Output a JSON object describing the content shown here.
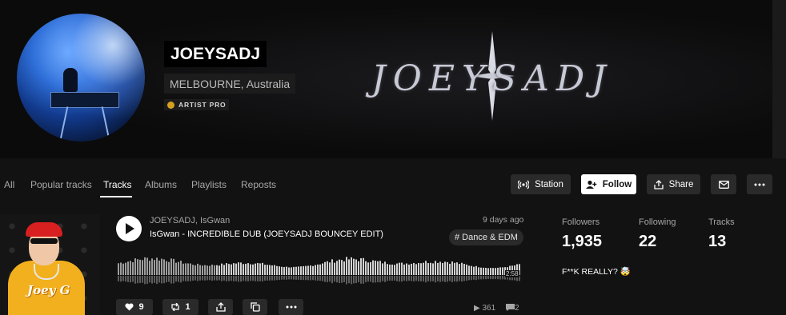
{
  "profile": {
    "name": "JOEYSADJ",
    "location": "MELBOURNE, Australia",
    "badge": "ARTIST PRO",
    "banner_logo_text": "JOEYSADJ"
  },
  "tabs": [
    {
      "label": "All",
      "active": false
    },
    {
      "label": "Popular tracks",
      "active": false
    },
    {
      "label": "Tracks",
      "active": true
    },
    {
      "label": "Albums",
      "active": false
    },
    {
      "label": "Playlists",
      "active": false
    },
    {
      "label": "Reposts",
      "active": false
    }
  ],
  "actions": {
    "station": "Station",
    "follow": "Follow",
    "share": "Share"
  },
  "track": {
    "artists": "JOEYSADJ, IsGwan",
    "title": "IsGwan - INCREDIBLE DUB (JOEYSADJ BOUNCEY EDIT)",
    "posted": "9 days ago",
    "genre": "# Dance & EDM",
    "duration": "2:58",
    "cover_text": "Joey G",
    "likes": "9",
    "reposts": "1",
    "plays": "361",
    "comments": "2",
    "progress": 0.24
  },
  "stats": [
    {
      "label": "Followers",
      "value": "1,935"
    },
    {
      "label": "Following",
      "value": "22"
    },
    {
      "label": "Tracks",
      "value": "13"
    }
  ],
  "bio": "F**K REALLY? 🤯",
  "colors": {
    "accent_gold": "#d6a21e",
    "page_bg": "#121212",
    "button_bg": "#2a2a2a"
  }
}
